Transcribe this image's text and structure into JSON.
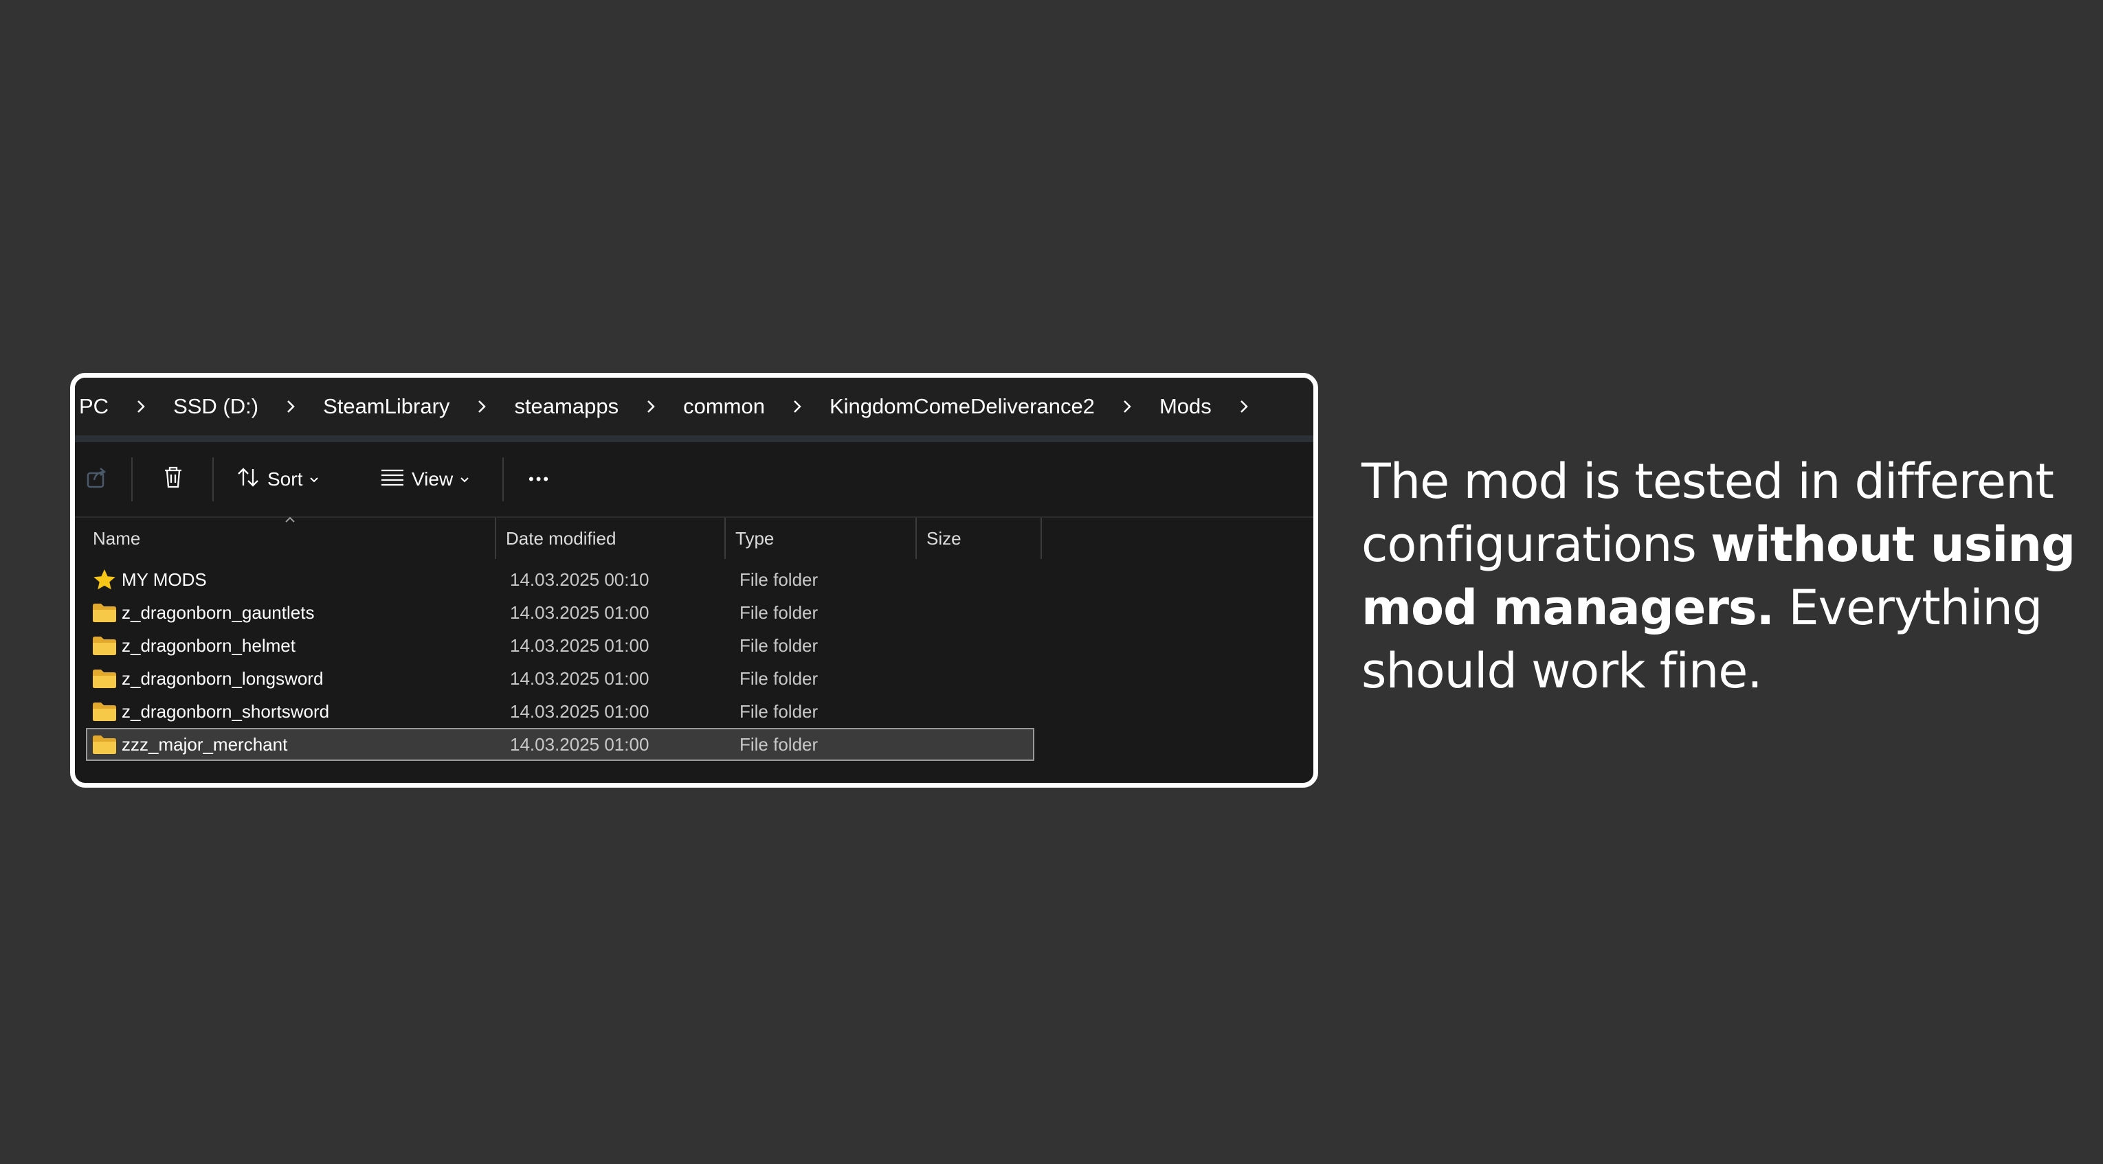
{
  "breadcrumb": [
    "PC",
    "SSD (D:)",
    "SteamLibrary",
    "steamapps",
    "common",
    "KingdomComeDeliverance2",
    "Mods"
  ],
  "toolbar": {
    "sort_label": "Sort",
    "view_label": "View",
    "more_label": "•••"
  },
  "columns": {
    "name": "Name",
    "date": "Date modified",
    "type": "Type",
    "size": "Size"
  },
  "rows": [
    {
      "name": "MY MODS",
      "date": "14.03.2025 00:10",
      "type": "File folder",
      "icon": "star-icon"
    },
    {
      "name": "z_dragonborn_gauntlets",
      "date": "14.03.2025 01:00",
      "type": "File folder",
      "icon": "folder-icon"
    },
    {
      "name": "z_dragonborn_helmet",
      "date": "14.03.2025 01:00",
      "type": "File folder",
      "icon": "folder-icon"
    },
    {
      "name": "z_dragonborn_longsword",
      "date": "14.03.2025 01:00",
      "type": "File folder",
      "icon": "folder-icon"
    },
    {
      "name": "z_dragonborn_shortsword",
      "date": "14.03.2025 01:00",
      "type": "File folder",
      "icon": "folder-icon"
    },
    {
      "name": "zzz_major_merchant",
      "date": "14.03.2025 01:00",
      "type": "File folder",
      "icon": "folder-icon",
      "selected": true
    }
  ],
  "caption": {
    "part1": "The mod is tested in different configurations ",
    "bold": "without using mod managers.",
    "part2": " Everything should work fine."
  },
  "colors": {
    "background": "#333333",
    "window": "#191919",
    "folder": "#f0c040",
    "star": "#f5c518",
    "frame": "#ffffff"
  }
}
